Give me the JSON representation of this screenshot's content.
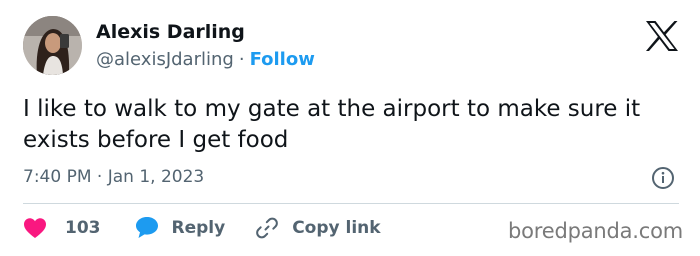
{
  "author": {
    "name": "Alexis Darling",
    "handle": "@alexisJdarling",
    "separator": "·",
    "follow_label": "Follow"
  },
  "tweet": {
    "text": "I like to walk to my gate at the airport to make sure it exists before I get food",
    "time": "7:40 PM",
    "date_separator": "·",
    "date": "Jan 1, 2023"
  },
  "actions": {
    "like_count": "103",
    "reply_label": "Reply",
    "copy_link_label": "Copy link"
  },
  "watermark": "boredpanda.com",
  "icons": {
    "logo": "x-logo-icon",
    "info": "info-icon",
    "like": "heart-icon",
    "reply": "speech-bubble-icon",
    "link": "link-icon"
  },
  "colors": {
    "accent": "#1d9bf0",
    "like": "#f91880",
    "text": "#0f1419",
    "muted": "#536471"
  }
}
